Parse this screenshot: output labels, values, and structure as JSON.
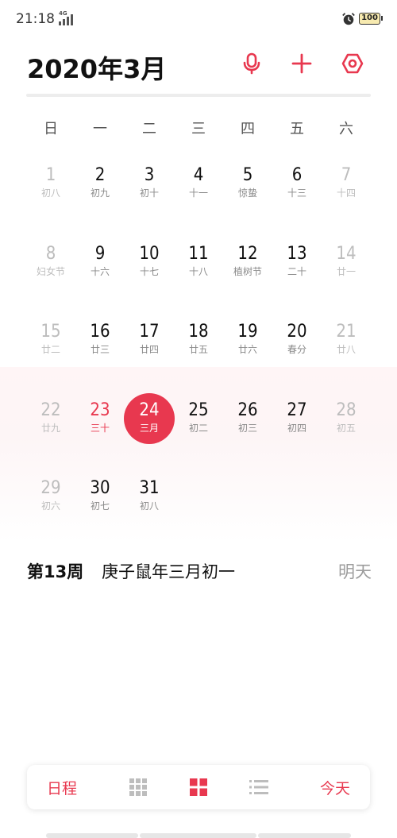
{
  "status": {
    "time": "21:18",
    "network": "4G",
    "battery": "100"
  },
  "header": {
    "title": "2020年3月",
    "icons": [
      "microphone-icon",
      "plus-icon",
      "settings-icon"
    ],
    "accent": "#e8384f"
  },
  "weekdays": [
    "日",
    "一",
    "二",
    "三",
    "四",
    "五",
    "六"
  ],
  "weeks": [
    [
      {
        "day": "1",
        "sub": "初八",
        "state": "dim"
      },
      {
        "day": "2",
        "sub": "初九",
        "state": "normal"
      },
      {
        "day": "3",
        "sub": "初十",
        "state": "normal"
      },
      {
        "day": "4",
        "sub": "十一",
        "state": "normal"
      },
      {
        "day": "5",
        "sub": "惊蛰",
        "state": "normal"
      },
      {
        "day": "6",
        "sub": "十三",
        "state": "normal"
      },
      {
        "day": "7",
        "sub": "十四",
        "state": "dim"
      }
    ],
    [
      {
        "day": "8",
        "sub": "妇女节",
        "state": "dim"
      },
      {
        "day": "9",
        "sub": "十六",
        "state": "normal"
      },
      {
        "day": "10",
        "sub": "十七",
        "state": "normal"
      },
      {
        "day": "11",
        "sub": "十八",
        "state": "normal"
      },
      {
        "day": "12",
        "sub": "植树节",
        "state": "normal"
      },
      {
        "day": "13",
        "sub": "二十",
        "state": "normal"
      },
      {
        "day": "14",
        "sub": "廿一",
        "state": "dim"
      }
    ],
    [
      {
        "day": "15",
        "sub": "廿二",
        "state": "dim"
      },
      {
        "day": "16",
        "sub": "廿三",
        "state": "normal"
      },
      {
        "day": "17",
        "sub": "廿四",
        "state": "normal"
      },
      {
        "day": "18",
        "sub": "廿五",
        "state": "normal"
      },
      {
        "day": "19",
        "sub": "廿六",
        "state": "normal"
      },
      {
        "day": "20",
        "sub": "春分",
        "state": "normal"
      },
      {
        "day": "21",
        "sub": "廿八",
        "state": "dim"
      }
    ],
    [
      {
        "day": "22",
        "sub": "廿九",
        "state": "dim"
      },
      {
        "day": "23",
        "sub": "三十",
        "state": "red"
      },
      {
        "day": "24",
        "sub": "三月",
        "state": "selected"
      },
      {
        "day": "25",
        "sub": "初二",
        "state": "normal"
      },
      {
        "day": "26",
        "sub": "初三",
        "state": "normal"
      },
      {
        "day": "27",
        "sub": "初四",
        "state": "normal"
      },
      {
        "day": "28",
        "sub": "初五",
        "state": "dim"
      }
    ],
    [
      {
        "day": "29",
        "sub": "初六",
        "state": "dim"
      },
      {
        "day": "30",
        "sub": "初七",
        "state": "normal"
      },
      {
        "day": "31",
        "sub": "初八",
        "state": "normal"
      },
      {
        "day": "",
        "sub": "",
        "state": "empty"
      },
      {
        "day": "",
        "sub": "",
        "state": "empty"
      },
      {
        "day": "",
        "sub": "",
        "state": "empty"
      },
      {
        "day": "",
        "sub": "",
        "state": "empty"
      }
    ]
  ],
  "info": {
    "week_label": "第13周",
    "lunar_date": "庚子鼠年三月初一",
    "tomorrow": "明天"
  },
  "bottom_nav": {
    "schedule": "日程",
    "today": "今天",
    "icons": [
      "year-view-icon",
      "month-view-icon",
      "list-view-icon"
    ]
  }
}
